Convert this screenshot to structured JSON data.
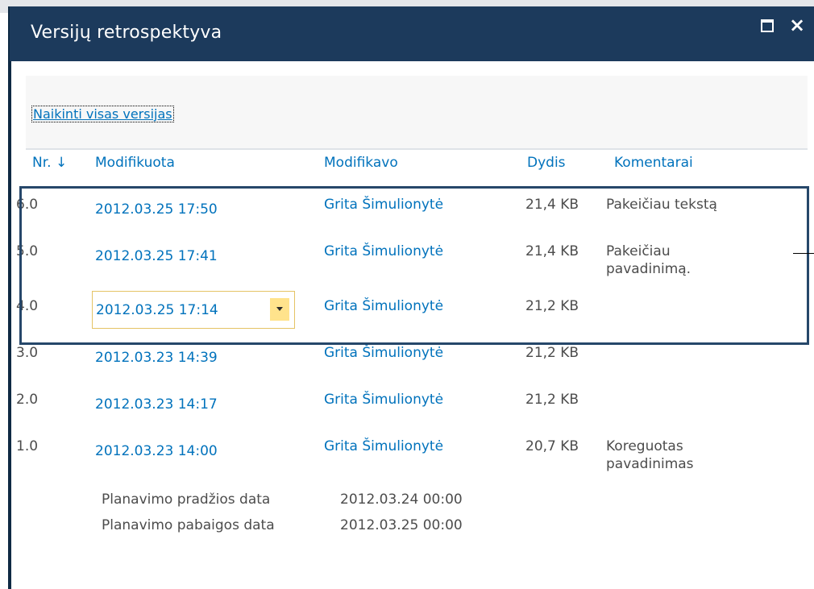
{
  "dialog": {
    "title": "Versijų retrospektyva",
    "maximize_icon": "maximize-icon",
    "close_icon": "close-icon",
    "close_glyph": "×"
  },
  "toolbar": {
    "delete_all_label": "Naikinti visas versijas"
  },
  "table": {
    "headers": {
      "nr": "Nr. ↓",
      "modified": "Modifikuota",
      "modified_by": "Modifikavo",
      "size": "Dydis",
      "comments": "Komentarai"
    },
    "rows": [
      {
        "nr": "6.0",
        "date": "2012.03.25 17:50",
        "author": "Grita Šimulionytė",
        "size": "21,4 KB",
        "comment_line1": "Pakeičiau tekstą",
        "comment_line2": ""
      },
      {
        "nr": "5.0",
        "date": "2012.03.25 17:41",
        "author": "Grita Šimulionytė",
        "size": "21,4 KB",
        "comment_line1": "Pakeičiau",
        "comment_line2": "pavadinimą."
      },
      {
        "nr": "4.0",
        "date": "2012.03.25 17:14",
        "author": "Grita Šimulionytė",
        "size": "21,2 KB",
        "comment_line1": "",
        "comment_line2": ""
      },
      {
        "nr": "3.0",
        "date": "2012.03.23 14:39",
        "author": "Grita Šimulionytė",
        "size": "21,2 KB",
        "comment_line1": "",
        "comment_line2": ""
      },
      {
        "nr": "2.0",
        "date": "2012.03.23 14:17",
        "author": "Grita Šimulionytė",
        "size": "21,2 KB",
        "comment_line1": "",
        "comment_line2": ""
      },
      {
        "nr": "1.0",
        "date": "2012.03.23 14:00",
        "author": "Grita Šimulionytė",
        "size": "20,7 KB",
        "comment_line1": "Koreguotas",
        "comment_line2": "pavadinimas"
      }
    ],
    "dropdown_icon": "chevron-down-icon"
  },
  "metadata": {
    "start_label": "Planavimo pradžios data",
    "start_value": "2012.03.24 00:00",
    "end_label": "Planavimo pabaigos data",
    "end_value": "2012.03.25 00:00"
  },
  "colors": {
    "titlebar": "#1c3a5c",
    "link": "#0072bc",
    "highlight_border": "#26476a",
    "dropdown_button": "#ffe38c"
  }
}
